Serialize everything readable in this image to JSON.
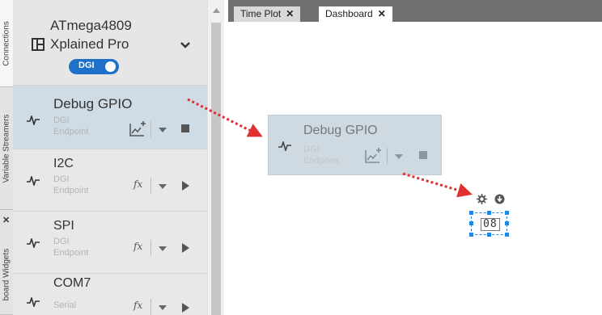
{
  "side_tabs": [
    "Connections",
    "Variable Streamers",
    "board Widgets"
  ],
  "device": {
    "name_line1": "ATmega4809",
    "name_line2": "Xplained Pro",
    "dgi_label": "DGI",
    "dgi_enabled": true
  },
  "endpoints": [
    {
      "name": "Debug GPIO",
      "type_line1": "DGI",
      "type_line2": "Endpoint",
      "action_icon": "plot-add-icon",
      "control": "stop",
      "selected": true
    },
    {
      "name": "I2C",
      "type_line1": "DGI",
      "type_line2": "Endpoint",
      "action_icon": "function-icon",
      "control": "play",
      "selected": false
    },
    {
      "name": "SPI",
      "type_line1": "DGI",
      "type_line2": "Endpoint",
      "action_icon": "function-icon",
      "control": "play",
      "selected": false
    },
    {
      "name": "COM7",
      "type_line1": "Serial",
      "type_line2": "",
      "action_icon": "function-icon",
      "control": "play",
      "selected": false
    }
  ],
  "tabs": [
    {
      "label": "Time Plot",
      "active": false
    },
    {
      "label": "Dashboard",
      "active": true
    }
  ],
  "drag_preview": {
    "name": "Debug GPIO",
    "type_line1": "DGI",
    "type_line2": "Endpoint"
  },
  "widget": {
    "display": "08"
  },
  "colors": {
    "accent": "#1e70c8",
    "selected_bg": "#cfdbe5",
    "arrow": "#e03030"
  }
}
